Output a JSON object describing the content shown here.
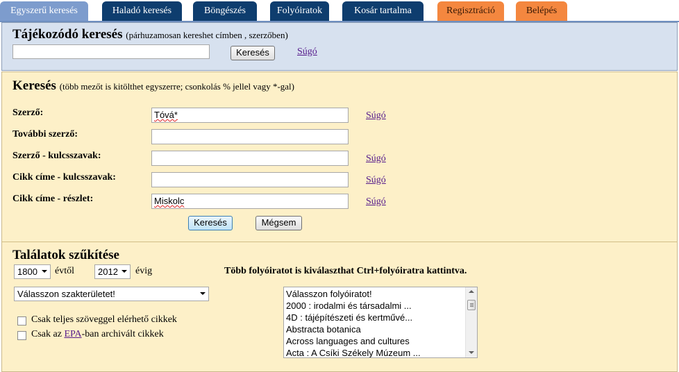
{
  "tabs": [
    {
      "label": "Egyszerű keresés"
    },
    {
      "label": "Haladó keresés"
    },
    {
      "label": "Böngészés"
    },
    {
      "label": "Folyóiratok"
    },
    {
      "label": "Kosár tartalma"
    },
    {
      "label": "Regisztráció"
    },
    {
      "label": "Belépés"
    }
  ],
  "quick_search": {
    "title": "Tájékozódó keresés",
    "note": "(párhuzamosan kereshet címben , szerzőben)",
    "value": "",
    "button": "Keresés",
    "help": "Súgó"
  },
  "search": {
    "title": "Keresés",
    "note": "(több mezőt is kitölthet egyszerre; csonkolás % jellel vagy *-gal)",
    "fields": [
      {
        "label": "Szerző:",
        "value": "Tóvá*",
        "help": "Súgó"
      },
      {
        "label": "További szerző:",
        "value": ""
      },
      {
        "label": "Szerző - kulcsszavak:",
        "value": "",
        "help": "Súgó"
      },
      {
        "label": "Cikk címe - kulcsszavak:",
        "value": "",
        "help": "Súgó"
      },
      {
        "label": "Cikk címe - részlet:",
        "value": "Miskolc",
        "help": "Súgó"
      }
    ],
    "submit": "Keresés",
    "cancel": "Mégsem"
  },
  "narrow": {
    "title": "Találatok szűkítése",
    "year_from": "1800",
    "year_from_label": "évtől",
    "year_to": "2012",
    "year_to_label": "évig",
    "field_select": "Válasszon szakterületet!",
    "checkbox_fulltext": "Csak teljes szöveggel elérhető cikkek",
    "checkbox_epa_prefix": "Csak az",
    "checkbox_epa_link": "EPA",
    "checkbox_epa_suffix": "-ban archivált cikkek",
    "journals_hint": "Több folyóiratot is kiválaszthat Ctrl+folyóiratra kattintva.",
    "journals": [
      "Válasszon folyóiratot!",
      "2000 : irodalmi és társadalmi ...",
      "4D : tájépítészeti és kertművé...",
      "Abstracta botanica",
      "Across languages and cultures",
      "Acta : A Csíki Székely Múzeum ..."
    ]
  }
}
